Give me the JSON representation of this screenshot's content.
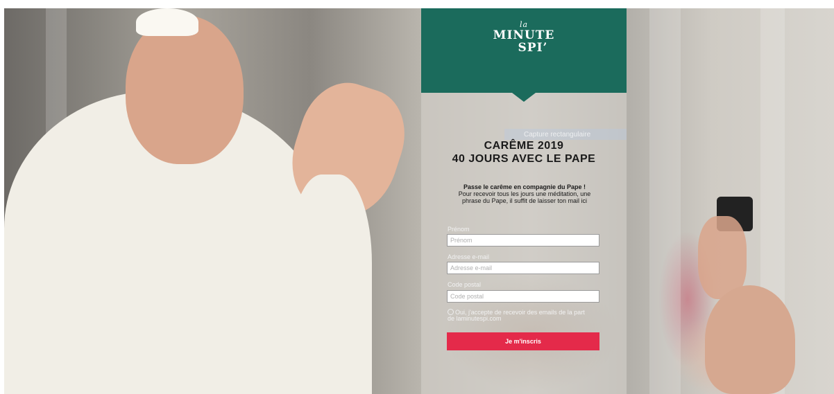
{
  "logo": {
    "line1": "la",
    "line2": "MINUTE",
    "line3": "SPI’"
  },
  "tooltip_ghost": "Capture rectangulaire",
  "title": {
    "line1": "CARÊME 2019",
    "line2": "40 JOURS AVEC LE PAPE"
  },
  "intro": {
    "bold_line": "Passe le carême en compagnie du Pape !",
    "line2": "Pour recevoir tous les jours une méditation, une",
    "line3": "phrase du Pape, il suffit de laisser ton mail ici"
  },
  "form": {
    "first_name": {
      "label": "Prénom",
      "placeholder": "Prénom",
      "value": ""
    },
    "email": {
      "label": "Adresse e-mail",
      "placeholder": "Adresse e-mail",
      "value": ""
    },
    "postal_code": {
      "label": "Code postal",
      "placeholder": "Code postal",
      "value": ""
    },
    "consent": {
      "line1": "Oui, j'accepte de recevoir des emails de la part",
      "line2": "de laminutespi.com",
      "checked": false
    },
    "submit_label": "Je m'inscris"
  },
  "colors": {
    "header_green": "#1b6b5c",
    "submit_red": "#e42a4a"
  }
}
